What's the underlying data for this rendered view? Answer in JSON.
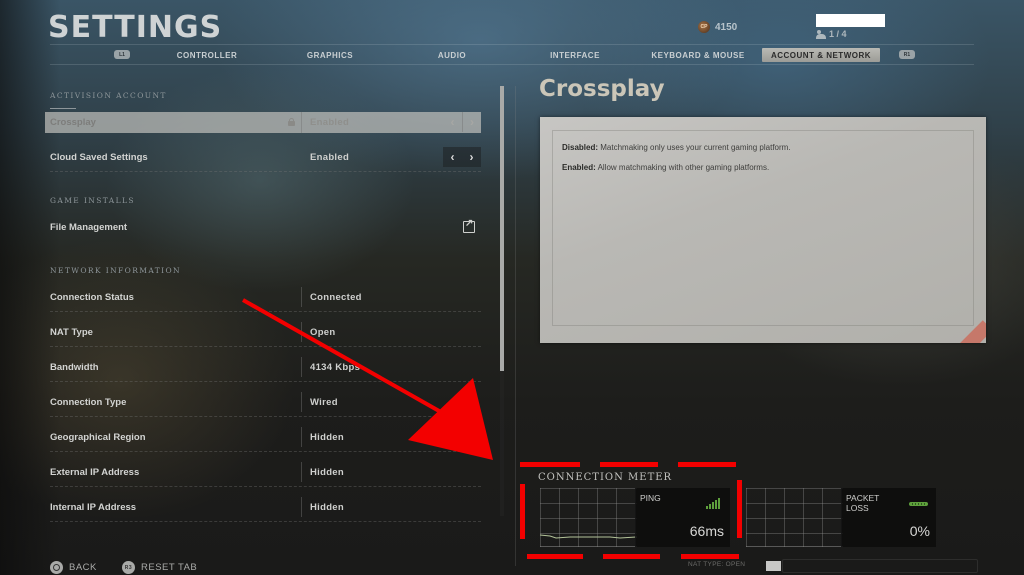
{
  "header": {
    "title": "SETTINGS",
    "cp_badge": "CP",
    "cp_amount": "4150",
    "party": "1 / 4"
  },
  "tabs": {
    "left_shoulder": "L1",
    "right_shoulder": "R1",
    "items": [
      {
        "label": "CONTROLLER",
        "active": false
      },
      {
        "label": "GRAPHICS",
        "active": false
      },
      {
        "label": "AUDIO",
        "active": false
      },
      {
        "label": "INTERFACE",
        "active": false
      },
      {
        "label": "KEYBOARD & MOUSE",
        "active": false
      },
      {
        "label": "ACCOUNT & NETWORK",
        "active": true
      }
    ]
  },
  "sections": {
    "account": "ACTIVISION ACCOUNT",
    "installs": "GAME INSTALLS",
    "network": "NETWORK INFORMATION"
  },
  "account_rows": [
    {
      "label": "Crossplay",
      "value": "Enabled",
      "locked": true,
      "selected": true
    },
    {
      "label": "Cloud Saved Settings",
      "value": "Enabled"
    }
  ],
  "install_rows": [
    {
      "label": "File Management",
      "icon": "external-link-icon"
    }
  ],
  "network_rows": [
    {
      "label": "Connection Status",
      "value": "Connected"
    },
    {
      "label": "NAT Type",
      "value": "Open"
    },
    {
      "label": "Bandwidth",
      "value": "4134 Kbps"
    },
    {
      "label": "Connection Type",
      "value": "Wired"
    },
    {
      "label": "Geographical Region",
      "value": "Hidden"
    },
    {
      "label": "External IP Address",
      "value": "Hidden"
    },
    {
      "label": "Internal IP Address",
      "value": "Hidden"
    }
  ],
  "footer": {
    "back": "BACK",
    "reset_badge": "R3",
    "reset": "RESET TAB"
  },
  "detail": {
    "title": "Crossplay",
    "lines": [
      {
        "key": "Disabled:",
        "text": " Matchmaking only uses your current gaming platform."
      },
      {
        "key": "Enabled:",
        "text": " Allow matchmaking with other gaming platforms."
      }
    ]
  },
  "meter": {
    "title": "CONNECTION METER",
    "ping_label": "PING",
    "ping_value": "66ms",
    "ping_signal_bars": 4,
    "loss_label_1": "PACKET",
    "loss_label_2": "LOSS",
    "loss_value": "0%",
    "nat_footer": "NAT TYPE: OPEN"
  },
  "colors": {
    "accent_good": "#5ea03c",
    "annotation_red": "#f30000",
    "paper_stripe": "#c6786a"
  }
}
